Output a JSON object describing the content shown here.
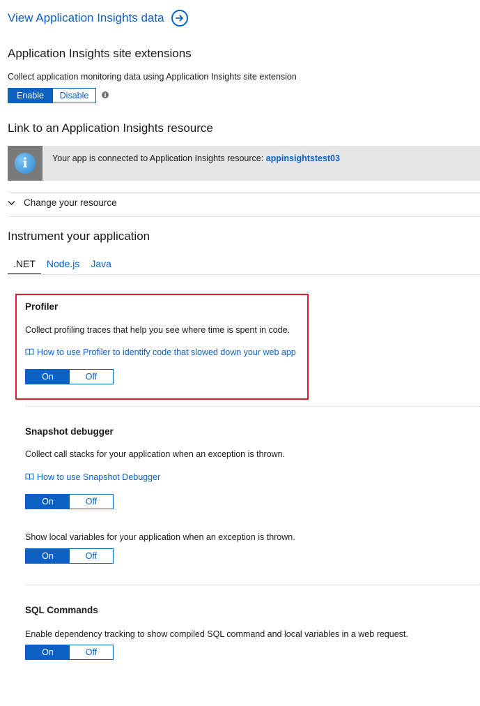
{
  "top_link": {
    "label": "View Application Insights data",
    "icon": "arrow-right-circle-icon"
  },
  "site_extensions": {
    "heading": "Application Insights site extensions",
    "description": "Collect application monitoring data using Application Insights site extension",
    "toggle": {
      "on_label": "Enable",
      "off_label": "Disable",
      "selected": "Enable"
    },
    "info_icon": "info-icon"
  },
  "link_resource": {
    "heading": "Link to an Application Insights resource",
    "banner": {
      "icon": "info-icon",
      "text": "Your app is connected to Application Insights resource: ",
      "resource_name": "appinsightstest03"
    },
    "expander": {
      "label": "Change your resource",
      "icon": "chevron-down-icon"
    }
  },
  "instrument": {
    "heading": "Instrument your application",
    "tabs": [
      {
        "label": ".NET",
        "active": true
      },
      {
        "label": "Node.js",
        "active": false
      },
      {
        "label": "Java",
        "active": false
      }
    ]
  },
  "profiler": {
    "title": "Profiler",
    "description": "Collect profiling traces that help you see where time is spent in code.",
    "link": "How to use Profiler to identify code that slowed down your web app",
    "toggle": {
      "on_label": "On",
      "off_label": "Off",
      "selected": "On"
    }
  },
  "snapshot": {
    "title": "Snapshot debugger",
    "description": "Collect call stacks for your application when an exception is thrown.",
    "link": "How to use Snapshot Debugger",
    "toggle": {
      "on_label": "On",
      "off_label": "Off",
      "selected": "On"
    },
    "locals_description": "Show local variables for your application when an exception is thrown.",
    "locals_toggle": {
      "on_label": "On",
      "off_label": "Off",
      "selected": "On"
    }
  },
  "sql": {
    "title": "SQL Commands",
    "description": "Enable dependency tracking to show compiled SQL command and local variables in a web request.",
    "toggle": {
      "on_label": "On",
      "off_label": "Off",
      "selected": "On"
    }
  },
  "colors": {
    "accent": "#0b62c4",
    "highlight_border": "#e0202a",
    "banner_bg": "#e6e6e6"
  }
}
